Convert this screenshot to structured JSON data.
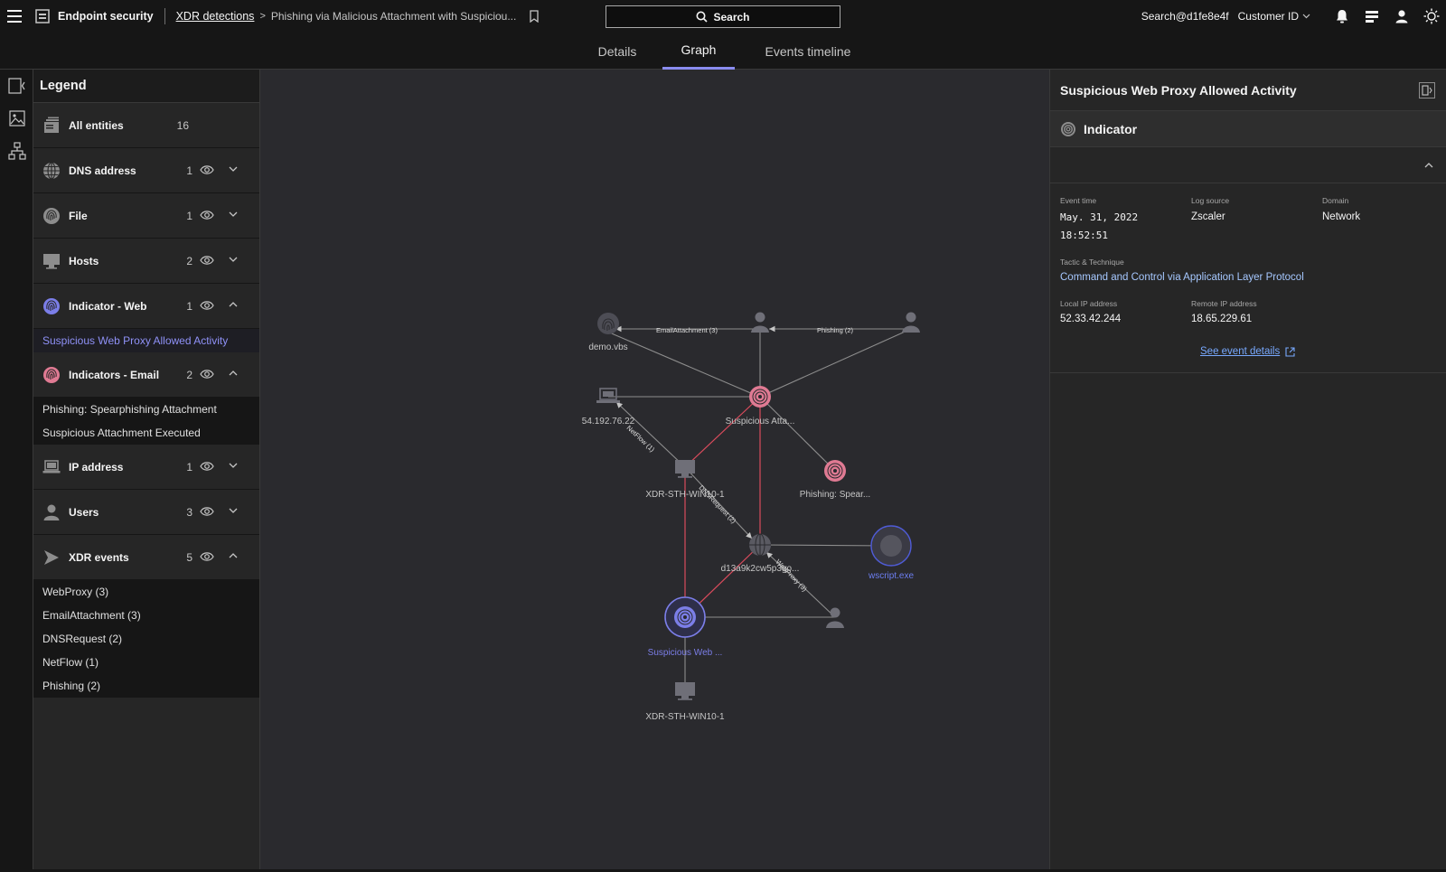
{
  "topbar": {
    "app_name": "Endpoint security",
    "breadcrumb_link": "XDR detections",
    "breadcrumb_current": "Phishing via Malicious Attachment with Suspiciou...",
    "search_label": "Search",
    "user": "Search@d1fe8e4f",
    "customer_label": "Customer ID"
  },
  "tabs": [
    {
      "label": "Details"
    },
    {
      "label": "Graph",
      "active": true
    },
    {
      "label": "Events timeline"
    }
  ],
  "legend": {
    "title": "Legend",
    "all_entities": {
      "label": "All entities",
      "count": "16"
    },
    "rows": [
      {
        "label": "DNS address",
        "count": "1",
        "icon": "globe-icon",
        "expanded": false
      },
      {
        "label": "File",
        "count": "1",
        "icon": "fingerprint-icon",
        "expanded": false
      },
      {
        "label": "Hosts",
        "count": "2",
        "icon": "monitor-icon",
        "expanded": false
      },
      {
        "label": "Indicator - Web",
        "count": "1",
        "icon": "indicator-web-icon",
        "expanded": true,
        "items": [
          "Suspicious Web Proxy Allowed Activity"
        ]
      },
      {
        "label": "Indicators - Email",
        "count": "2",
        "icon": "indicator-email-icon",
        "expanded": true,
        "items": [
          "Phishing: Spearphishing Attachment",
          "Suspicious Attachment Executed"
        ]
      },
      {
        "label": "IP address",
        "count": "1",
        "icon": "laptop-icon",
        "expanded": false
      },
      {
        "label": "Users",
        "count": "3",
        "icon": "user-icon",
        "expanded": false
      },
      {
        "label": "XDR events",
        "count": "5",
        "icon": "arrow-icon",
        "expanded": true,
        "items": [
          "WebProxy (3)",
          "EmailAttachment (3)",
          "DNSRequest (2)",
          "NetFlow (1)",
          "Phishing (2)"
        ]
      }
    ]
  },
  "graph": {
    "nodes": {
      "demo_vbs": "demo.vbs",
      "ip": "54.192.76.22",
      "susp_attachment": "Suspicious Atta...",
      "host_top": "XDR-STH-WIN10-1",
      "phishing_spear": "Phishing: Spear...",
      "dns": "d13a9k2cw5p3go...",
      "wscript": "wscript.exe",
      "susp_web": "Suspicious Web ...",
      "host_bottom": "XDR-STH-WIN10-1"
    },
    "edges": {
      "email_attachment": "EmailAttachment (3)",
      "phishing": "Phishing (2)",
      "netflow": "NetFlow (1)",
      "dnsrequest": "DNSRequest (2)",
      "webproxy": "WebProxy (3)"
    }
  },
  "panel": {
    "title": "Suspicious Web Proxy Allowed Activity",
    "section": "Indicator",
    "fields": {
      "event_time_label": "Event time",
      "event_time_date": "May. 31, 2022",
      "event_time_clock": "18:52:51",
      "log_source_label": "Log source",
      "log_source": "Zscaler",
      "domain_label": "Domain",
      "domain": "Network",
      "tactic_label": "Tactic & Technique",
      "tactic": "Command and Control via Application Layer Protocol",
      "local_ip_label": "Local IP address",
      "local_ip": "52.33.42.244",
      "remote_ip_label": "Remote IP address",
      "remote_ip": "18.65.229.61"
    },
    "see_details": "See event details"
  },
  "colors": {
    "accent": "#8a8cf0",
    "email_indicator": "#f08fa6",
    "red_edge": "#d94b5c",
    "link": "#78a9ff"
  }
}
